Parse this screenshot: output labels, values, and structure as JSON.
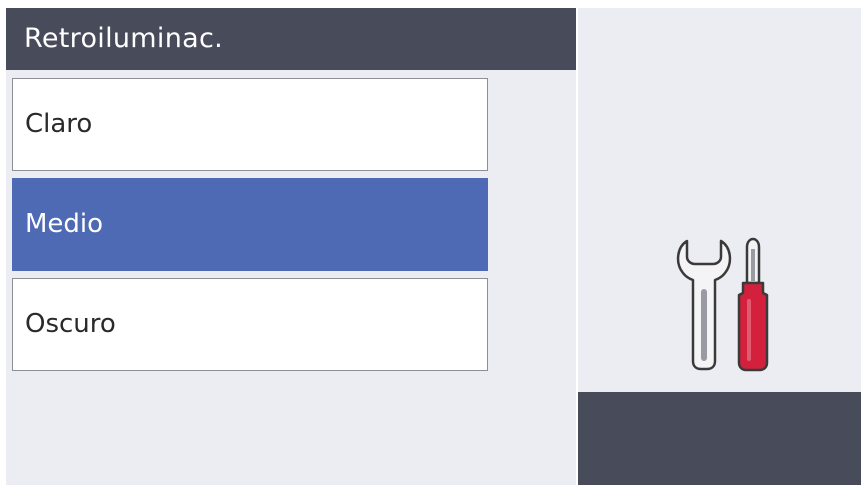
{
  "header": {
    "title": "Retroiluminac."
  },
  "options": [
    {
      "label": "Claro",
      "selected": false
    },
    {
      "label": "Medio",
      "selected": true
    },
    {
      "label": "Oscuro",
      "selected": false
    }
  ],
  "sidebar": {
    "icon": "wrench-screwdriver-icon"
  },
  "colors": {
    "header_bg": "#484b5a",
    "panel_bg": "#ececf3",
    "selected_bg": "#4f6ab5",
    "screwdriver_handle": "#d3203c"
  }
}
